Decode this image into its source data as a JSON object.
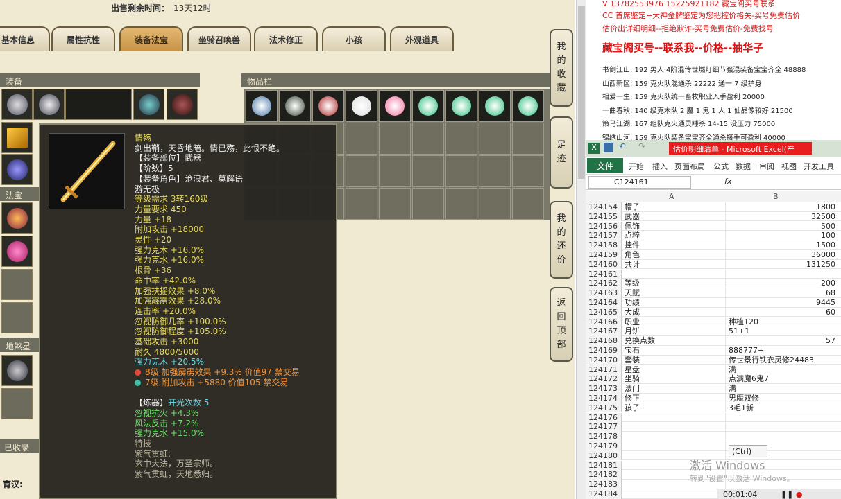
{
  "game": {
    "sale_time_label": "出售剩余时间：",
    "sale_time_value": "13天12时",
    "tabs": [
      "基本信息",
      "属性抗性",
      "装备法宝",
      "坐骑召唤兽",
      "法术修正",
      "小孩",
      "外观道具"
    ],
    "equipment_header": "装备",
    "inventory_header": "物品栏",
    "fabao_header": "法宝",
    "dishaxing_header": "地煞星",
    "collected_header": "已收录",
    "side_buttons": [
      "我的收藏",
      "足迹",
      "我的还价",
      "返回顶部"
    ],
    "bottom_name": "育汉:"
  },
  "tooltip": {
    "name": "情殇",
    "desc": "剑出鞘，天昏地暗。情已殇，此恨不绝。",
    "lines": [
      {
        "text": "【装备部位】武器",
        "color": "white"
      },
      {
        "text": "【阶数】5",
        "color": "white"
      },
      {
        "text": "【装备角色】沧浪君、莫解语",
        "color": "white"
      },
      {
        "text": "游无极",
        "color": "white"
      },
      {
        "text": "等级需求 3转160级",
        "color": "yellow"
      },
      {
        "text": "力量要求 450",
        "color": "yellow"
      },
      {
        "text": "力量 +18",
        "color": "yellow"
      },
      {
        "text": "附加攻击 +18000",
        "color": "yellow"
      },
      {
        "text": "灵性 +20",
        "color": "yellow"
      },
      {
        "text": "强力克木 +16.0%",
        "color": "yellow"
      },
      {
        "text": "强力克水 +16.0%",
        "color": "yellow"
      },
      {
        "text": "根骨 +36",
        "color": "yellow"
      },
      {
        "text": "命中率 +42.0%",
        "color": "yellow"
      },
      {
        "text": "加强扶摇效果 +8.0%",
        "color": "yellow"
      },
      {
        "text": "加强霹雳效果 +28.0%",
        "color": "yellow"
      },
      {
        "text": "连击率 +20.0%",
        "color": "yellow"
      },
      {
        "text": "忽视防御几率 +100.0%",
        "color": "yellow"
      },
      {
        "text": "忽视防御程度 +105.0%",
        "color": "yellow"
      },
      {
        "text": "基础攻击 +3000",
        "color": "yellow"
      },
      {
        "text": "耐久 4800/5000",
        "color": "yellow"
      },
      {
        "text": "强力克木 +20.5%",
        "color": "cyan"
      }
    ],
    "gems": [
      {
        "text": "8级 加强霹雳效果 +9.3% 价值97 禁交易",
        "dot": "#e04a3a"
      },
      {
        "text": "7级 附加攻击 +5880 价值105 禁交易",
        "dot": "#3ac0a0"
      }
    ],
    "refine_label": "【炼器】",
    "refine_count": "开光次数 5",
    "refine_lines": [
      "忽视抗火 +4.3%",
      "风法反击 +7.2%",
      "强力克水 +15.0%"
    ],
    "special_lines": [
      "特技",
      "紫气贯虹:",
      "玄中大法，万圣宗师。",
      "紫气贯虹，天地悉归。"
    ]
  },
  "ad": {
    "top_line": "V 13782553976    15225921182   藏宝阁买号联系",
    "line2": "CC 首席鉴定+大神金牌鉴定为您把控价格关-买号免费估价",
    "line3": "估价出详细明细--拒绝欺诈-买号免费估价-免费找号",
    "headline": "藏宝阁买号--联系我--价格--抽华子",
    "listings": [
      "书剑江山: 192 男人 4阶混传世燃灯细节强混装备宝宝齐全 48888",
      "山西新区: 159 克火队混通杀 22222 通一 7 级护身",
      "相爱一生: 159 克火队统一畜牧职业入手盈利 20000",
      "一曲春秋: 140 级克木队 2 魔 1 鬼 1 人 1 仙品像较好 21500",
      "策马江湖: 167 组队克火通灵睡杀 14-15 没压力 75000",
      "锦绣山河: 159 克火队装备宝宝齐全通杀接手可盈利 40000"
    ]
  },
  "excel": {
    "title": "估价明细清单 - Microsoft Excel(产",
    "ribbon_tabs": [
      "文件",
      "开始",
      "插入",
      "页面布局",
      "公式",
      "数据",
      "审阅",
      "视图",
      "开发工具"
    ],
    "name_box": "C124161",
    "fx": "fx",
    "col_a": "A",
    "col_b": "B",
    "rows": [
      {
        "n": "124154",
        "a": "帽子",
        "b": "1800",
        "num": true
      },
      {
        "n": "124155",
        "a": "武器",
        "b": "32500",
        "num": true
      },
      {
        "n": "124156",
        "a": "佩饰",
        "b": "500",
        "num": true
      },
      {
        "n": "124157",
        "a": "点粹",
        "b": "100",
        "num": true
      },
      {
        "n": "124158",
        "a": "挂件",
        "b": "1500",
        "num": true
      },
      {
        "n": "124159",
        "a": "角色",
        "b": "36000",
        "num": true
      },
      {
        "n": "124160",
        "a": "共计",
        "b": "131250",
        "num": true
      },
      {
        "n": "124161",
        "a": "",
        "b": "",
        "num": true
      },
      {
        "n": "124162",
        "a": "等级",
        "b": "200",
        "num": true
      },
      {
        "n": "124163",
        "a": "天赋",
        "b": "68",
        "num": true
      },
      {
        "n": "124164",
        "a": "功绩",
        "b": "9445",
        "num": true
      },
      {
        "n": "124165",
        "a": "大成",
        "b": "60",
        "num": true
      },
      {
        "n": "124166",
        "a": "职业",
        "b": "种植120",
        "num": false
      },
      {
        "n": "124167",
        "a": "月饼",
        "b": "51+1",
        "num": false
      },
      {
        "n": "124168",
        "a": "兑换点数",
        "b": "57",
        "num": true
      },
      {
        "n": "124169",
        "a": "宝石",
        "b": "888777+",
        "num": false
      },
      {
        "n": "124170",
        "a": "套装",
        "b": "传世景行铁衣灵修24483",
        "num": false
      },
      {
        "n": "124171",
        "a": "星盘",
        "b": "满",
        "num": false
      },
      {
        "n": "124172",
        "a": "坐骑",
        "b": "点满魔6鬼7",
        "num": false
      },
      {
        "n": "124173",
        "a": "法门",
        "b": "满",
        "num": false
      },
      {
        "n": "124174",
        "a": "修正",
        "b": "男魔双修",
        "num": false
      },
      {
        "n": "124175",
        "a": "孩子",
        "b": "3毛1新",
        "num": false
      },
      {
        "n": "124176",
        "a": "",
        "b": "",
        "num": true
      },
      {
        "n": "124177",
        "a": "",
        "b": "",
        "num": true
      },
      {
        "n": "124178",
        "a": "",
        "b": "",
        "num": true
      },
      {
        "n": "124179",
        "a": "",
        "b": "",
        "num": true
      },
      {
        "n": "124180",
        "a": "",
        "b": "",
        "num": true
      },
      {
        "n": "124181",
        "a": "",
        "b": "",
        "num": true
      },
      {
        "n": "124182",
        "a": "",
        "b": "",
        "num": true
      },
      {
        "n": "124183",
        "a": "",
        "b": "",
        "num": true
      },
      {
        "n": "124184",
        "a": "",
        "b": "",
        "num": true
      }
    ],
    "paste_label": "(Ctrl)",
    "watermark": "激活 Windows",
    "watermark_sub": "转到\"设置\"以激活 Windows。",
    "player_time": "00:01:04"
  }
}
